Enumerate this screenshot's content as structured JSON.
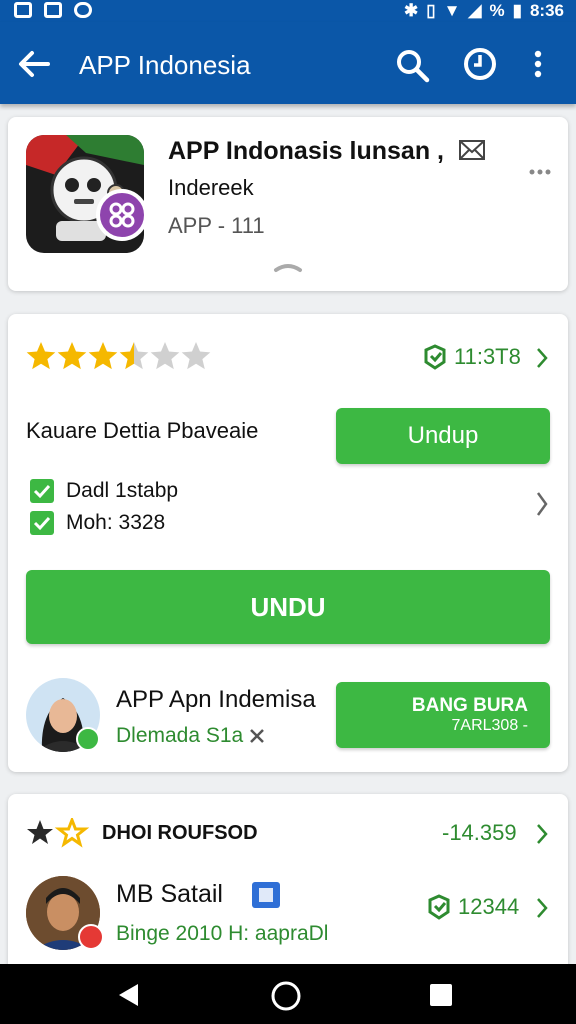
{
  "status_bar": {
    "battery": "%",
    "time": "8:36"
  },
  "app_bar": {
    "title": "APP Indonesia"
  },
  "app_card": {
    "name": "APP Indonasis lunsan ,",
    "developer": "Indereek",
    "version": "APP - 111"
  },
  "detail_card": {
    "rating": 3.5,
    "rating_max": 6,
    "downloads": "11:3T8",
    "name": "Kauare Dettia Pbaveaie",
    "install_label": "Undup",
    "checks": [
      "Dadl 1stabp",
      "Moh:  3328"
    ],
    "primary_label": "UNDU",
    "account_name": "APP Apn Indemisa",
    "account_sub": "Dlemada S1a",
    "side_button_line1": "BANG BURA",
    "side_button_line2": "7ARL308 -"
  },
  "review_card": {
    "header": "DHOI ROUFSOD",
    "header_value": "-14.359",
    "reviewer": "MB Satail",
    "reviewer_value": "12344",
    "reviewer_sub": "Binge 2010 H: aapraDl"
  },
  "colors": {
    "primary": "#0b57a8",
    "accent": "#3db843",
    "star": "#f5b800"
  }
}
